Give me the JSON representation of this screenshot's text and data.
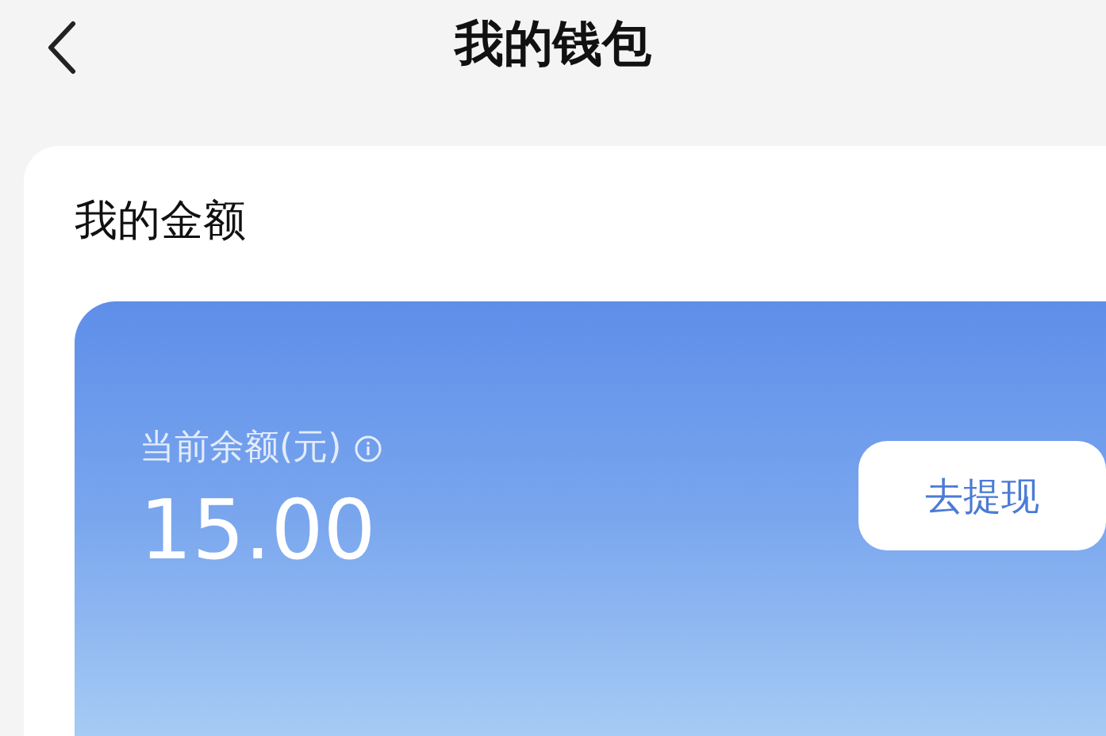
{
  "header": {
    "title": "我的钱包"
  },
  "wallet": {
    "title": "我的金额",
    "balance_label": "当前余额(元)",
    "balance": "15.00",
    "withdraw_button": "去提现"
  }
}
